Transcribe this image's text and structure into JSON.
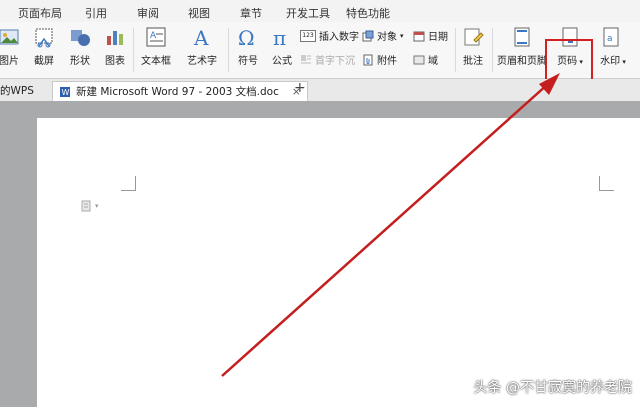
{
  "menubar": {
    "items": [
      "页面布局",
      "引用",
      "审阅",
      "视图",
      "章节",
      "开发工具",
      "特色功能"
    ]
  },
  "toolbar": {
    "buttons": [
      {
        "label": "图片",
        "icon": "picture-icon"
      },
      {
        "label": "截屏",
        "icon": "screenshot-icon"
      },
      {
        "label": "形状",
        "icon": "shapes-icon"
      },
      {
        "label": "图表",
        "icon": "chart-icon"
      },
      {
        "label": "文本框",
        "icon": "textbox-icon"
      },
      {
        "label": "艺术字",
        "icon": "wordart-icon"
      },
      {
        "label": "符号",
        "icon": "omega-icon"
      },
      {
        "label": "公式",
        "icon": "pi-icon"
      },
      {
        "label": "批注",
        "icon": "comment-icon"
      },
      {
        "label": "页眉和页脚",
        "icon": "header-footer-icon"
      },
      {
        "label": "页码",
        "icon": "page-number-icon"
      },
      {
        "label": "水印",
        "icon": "watermark-icon"
      }
    ],
    "small_buttons": [
      {
        "label": "插入数字",
        "icon": "insert-number-icon"
      },
      {
        "label": "对象",
        "icon": "object-icon"
      },
      {
        "label": "日期",
        "icon": "date-icon"
      },
      {
        "label": "首字下沉",
        "icon": "drop-cap-icon"
      },
      {
        "label": "附件",
        "icon": "attachment-icon"
      },
      {
        "label": "域",
        "icon": "field-icon"
      }
    ],
    "badge_123": "123"
  },
  "tabs": [
    {
      "label": "的WPS"
    },
    {
      "label": "新建 Microsoft Word 97 - 2003 文档.doc"
    }
  ],
  "tab_new_symbol": "+",
  "tab_close_symbol": "×",
  "watermark": "头条 @不甘寂寞的养老院",
  "colors": {
    "highlight": "#d12020",
    "arrow": "#c41e1e"
  }
}
